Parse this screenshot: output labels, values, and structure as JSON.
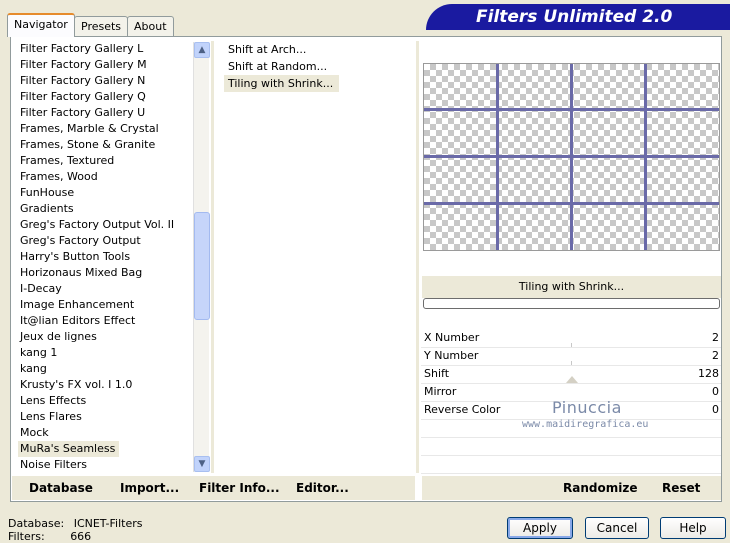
{
  "tabs": [
    {
      "label": "Navigator",
      "active": true
    },
    {
      "label": "Presets",
      "active": false
    },
    {
      "label": "About",
      "active": false
    }
  ],
  "banner": {
    "title": "Filters Unlimited 2.0"
  },
  "filter_categories": [
    "Filter Factory Gallery L",
    "Filter Factory Gallery M",
    "Filter Factory Gallery N",
    "Filter Factory Gallery Q",
    "Filter Factory Gallery U",
    "Frames, Marble & Crystal",
    "Frames, Stone & Granite",
    "Frames, Textured",
    "Frames, Wood",
    "FunHouse",
    "Gradients",
    "Greg's Factory Output Vol. II",
    "Greg's Factory Output",
    "Harry's Button Tools",
    "Horizonaus Mixed Bag",
    "I-Decay",
    "Image Enhancement",
    "It@lian Editors Effect",
    "Jeux de lignes",
    "kang 1",
    "kang",
    "Krusty's FX vol. I 1.0",
    "Lens Effects",
    "Lens Flares",
    "Mock",
    "MuRa's Seamless",
    "Noise Filters"
  ],
  "selected_category": "MuRa's Seamless",
  "effects": [
    "Shift at Arch...",
    "Shift at Random...",
    "Tiling with Shrink..."
  ],
  "selected_effect": "Tiling with Shrink...",
  "effect_title": "Tiling with Shrink...",
  "parameters": [
    {
      "name": "X Number",
      "value": "2"
    },
    {
      "name": "Y Number",
      "value": "2"
    },
    {
      "name": "Shift",
      "value": "128"
    },
    {
      "name": "Mirror",
      "value": "0"
    },
    {
      "name": "Reverse Color",
      "value": "0"
    }
  ],
  "watermark": {
    "name": "Pinuccia",
    "url": "www.maidiregrafica.eu"
  },
  "left_toolbar": [
    "Database",
    "Import...",
    "Filter Info...",
    "Editor..."
  ],
  "right_toolbar": [
    "Randomize",
    "Reset"
  ],
  "status": {
    "database_label": "Database:",
    "database_value": "ICNET-Filters",
    "filters_label": "Filters:",
    "filters_value": "666"
  },
  "dialog_buttons": {
    "apply": "Apply",
    "cancel": "Cancel",
    "help": "Help"
  },
  "icons": {
    "scroll_up": "scroll-up-arrow-icon",
    "scroll_down": "scroll-down-arrow-icon"
  },
  "colors": {
    "banner": "#1a1aa0",
    "tab_accent": "#e68b2c",
    "grid": "#6a6aa8"
  }
}
